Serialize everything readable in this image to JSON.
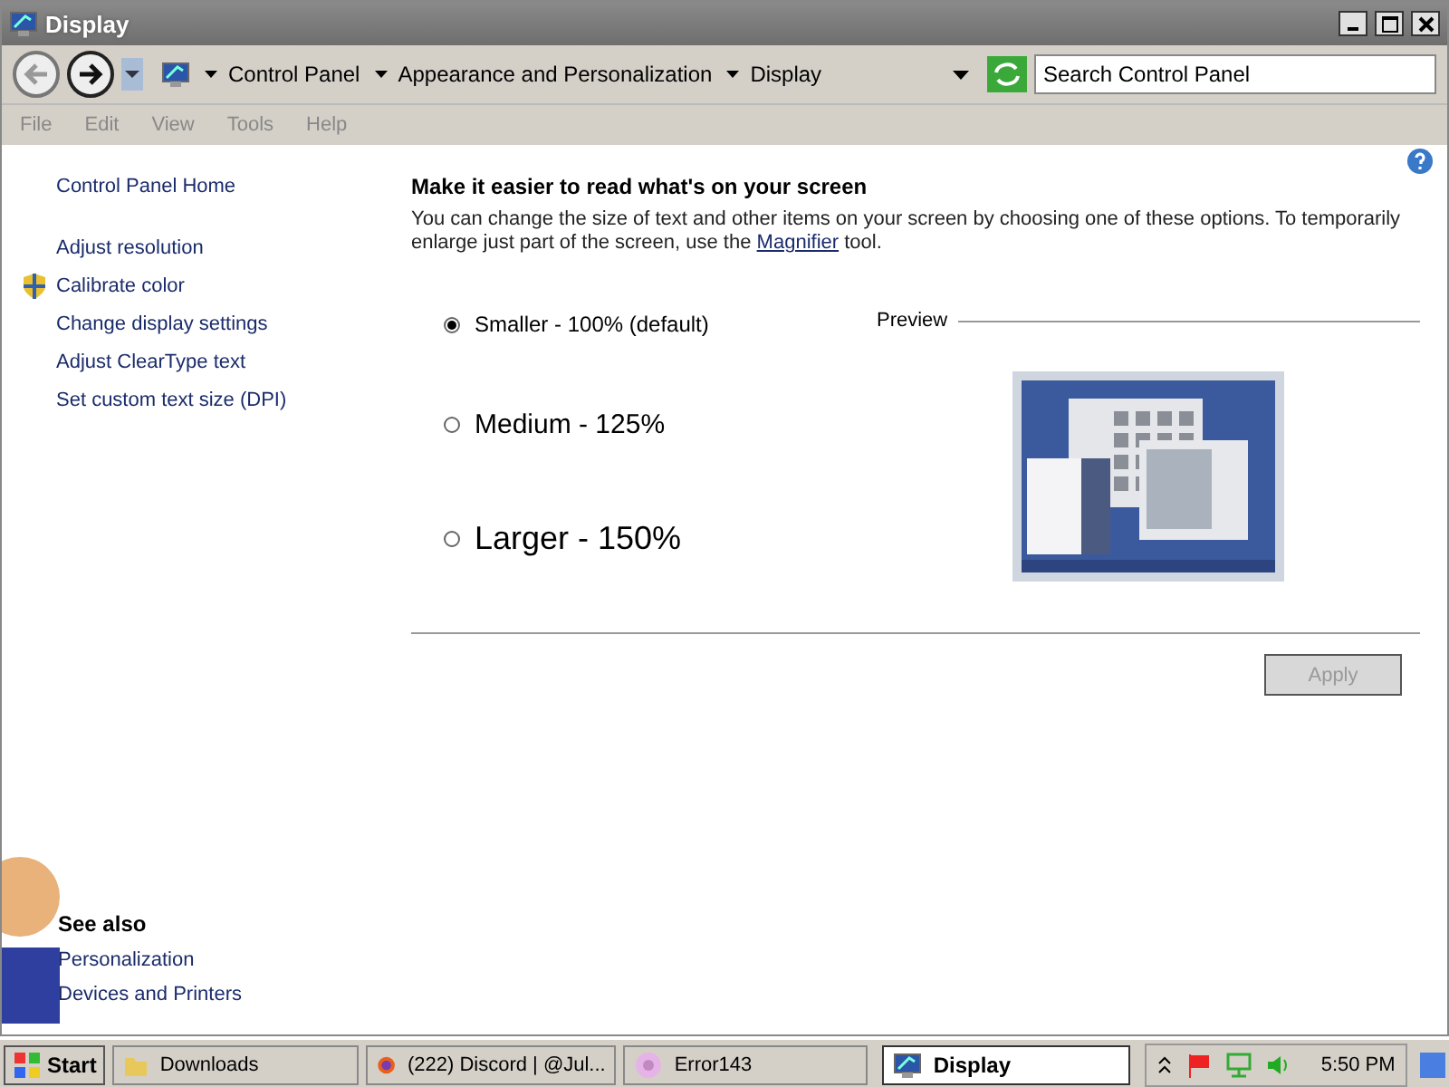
{
  "window": {
    "title": "Display"
  },
  "address_bar": {
    "crumbs": [
      "Control Panel",
      "Appearance and Personalization",
      "Display"
    ],
    "search": {
      "placeholder": "Search Control Panel"
    }
  },
  "menu": [
    {
      "label": "File",
      "disabled": true
    },
    {
      "label": "Edit",
      "disabled": true
    },
    {
      "label": "View",
      "disabled": true
    },
    {
      "label": "Tools",
      "disabled": true
    },
    {
      "label": "Help",
      "disabled": true
    }
  ],
  "sidebar": {
    "home": "Control Panel Home",
    "tasks": [
      {
        "label": "Adjust resolution",
        "kind": "plain"
      },
      {
        "label": "Calibrate color",
        "kind": "shield"
      },
      {
        "label": "Change display settings",
        "kind": "plain"
      },
      {
        "label": "Adjust ClearType text",
        "kind": "plain"
      },
      {
        "label": "Set custom text size (DPI)",
        "kind": "plain"
      }
    ],
    "see_also": {
      "title": "See also",
      "links": [
        "Personalization",
        "Devices and Printers"
      ]
    }
  },
  "main": {
    "heading": "Make it easier to read what's on your screen",
    "intro_before": "You can change the size of text and other items on your screen by choosing one of these options. To temporarily enlarge just part of the screen, use the",
    "link": "Magnifier",
    "intro_after": "tool.",
    "options": [
      {
        "label": "Smaller - 100% (default)",
        "kind": "small",
        "selected": true
      },
      {
        "label": "Medium - 125%",
        "kind": "medium",
        "selected": false
      },
      {
        "label": "Larger - 150%",
        "kind": "large",
        "selected": false
      }
    ],
    "preview_label": "Preview",
    "apply": {
      "label": "Apply",
      "disabled": true
    }
  },
  "taskbar": {
    "start": "Start",
    "items": [
      {
        "label": "Downloads",
        "kind": "folder",
        "selected": false
      },
      {
        "label": "(222) Discord | @Jul...",
        "kind": "browser",
        "selected": false
      },
      {
        "label": "Error143",
        "kind": "app",
        "selected": false
      },
      {
        "label": "Display",
        "kind": "display",
        "selected": true
      }
    ],
    "clock": "5:50 PM"
  }
}
